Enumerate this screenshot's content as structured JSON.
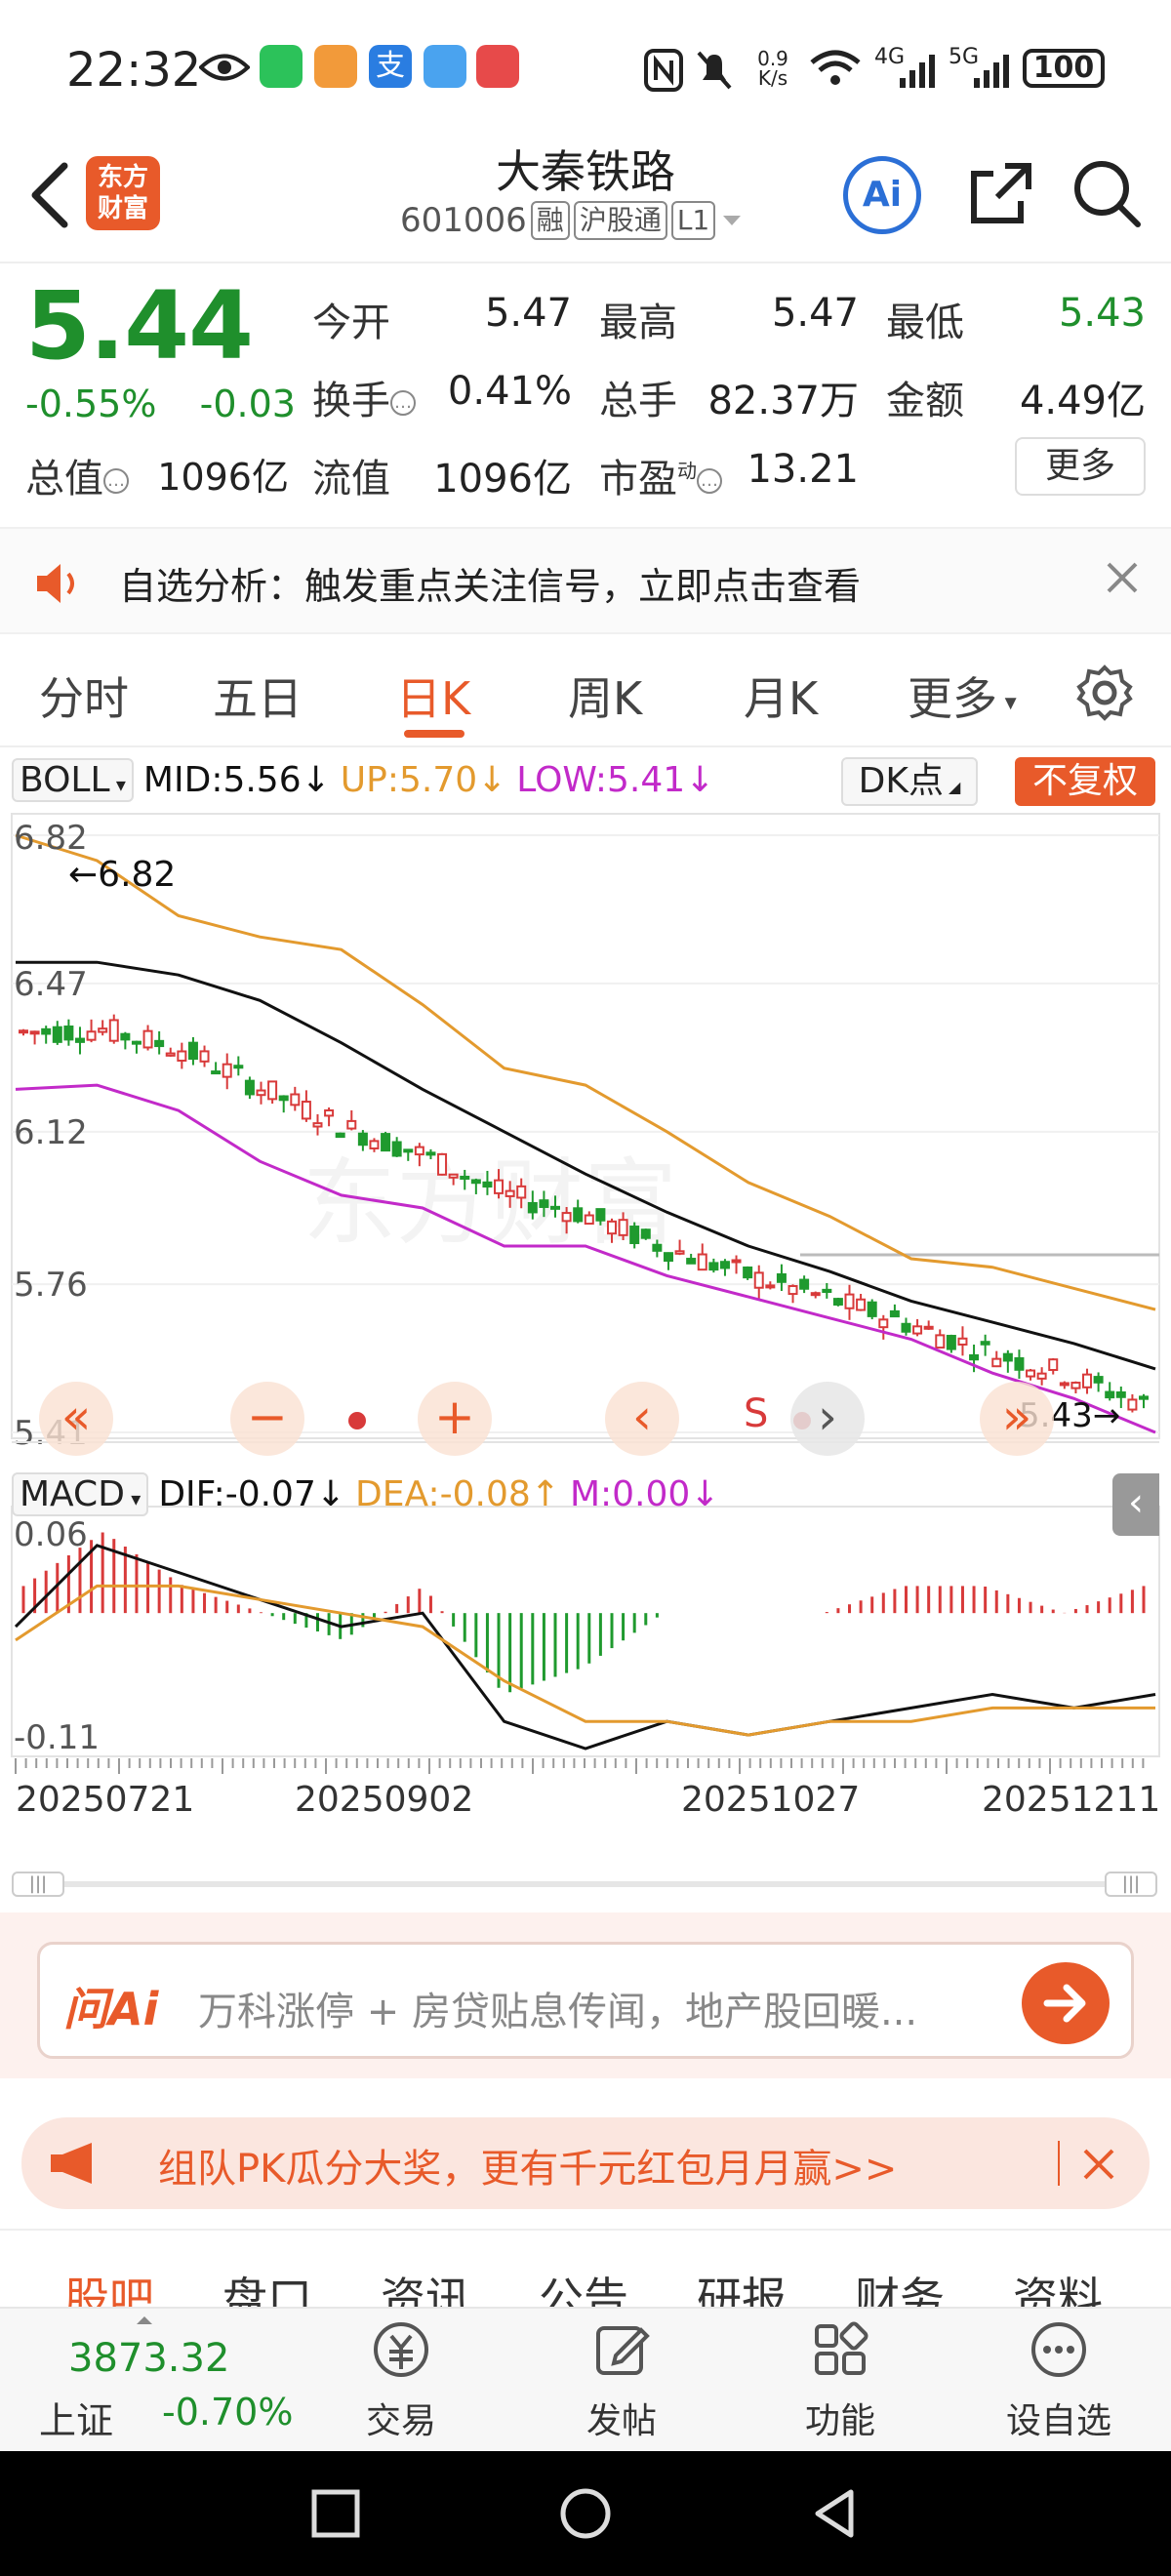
{
  "status_bar": {
    "time": "22:32",
    "net_speed": "0.9 K/s",
    "network": "4G",
    "network2": "5G",
    "battery": "100"
  },
  "header": {
    "brand": "东方财富",
    "stock_name": "大秦铁路",
    "stock_code": "601006",
    "tags": [
      "融",
      "沪股通",
      "L1"
    ],
    "ai_label": "Ai"
  },
  "quote": {
    "price": "5.44",
    "change_pct": "-0.55%",
    "change": "-0.03",
    "open_label": "今开",
    "open": "5.47",
    "high_label": "最高",
    "high": "5.47",
    "low_label": "最低",
    "low": "5.43",
    "turnover_label": "换手",
    "turnover": "0.41%",
    "volume_label": "总手",
    "volume": "82.37万",
    "amount_label": "金额",
    "amount": "4.49亿",
    "mktcap_label": "总值",
    "mktcap": "1096亿",
    "float_label": "流值",
    "float": "1096亿",
    "pe_label": "市盈",
    "pe_sup": "动",
    "pe": "13.21",
    "more_label": "更多"
  },
  "notice": {
    "text": "自选分析：触发重点关注信号，立即点击查看"
  },
  "tabs": [
    "分时",
    "五日",
    "日K",
    "周K",
    "月K",
    "更多"
  ],
  "active_tab": "日K",
  "boll": {
    "name": "BOLL",
    "mid": "MID:5.56",
    "up": "UP:5.70",
    "low": "LOW:5.41",
    "dk_label": "DK点",
    "fq_label": "不复权",
    "max_marker": "←6.82",
    "min_marker": "5.43→",
    "y_ticks": [
      "6.82",
      "6.47",
      "6.12",
      "5.76",
      "5.41"
    ],
    "signal": "S"
  },
  "macd": {
    "name": "MACD",
    "dif": "DIF:-0.07",
    "dea": "DEA:-0.08",
    "m": "M:0.00",
    "y_ticks": [
      "0.06",
      "-0.11"
    ]
  },
  "x_dates": [
    "20250721",
    "20250902",
    "20251027",
    "20251211"
  ],
  "colors": {
    "up": "#d83a3a",
    "down": "#1f9a2e",
    "mid": "#111111",
    "upper": "#e39a2e",
    "lower": "#c22ac9",
    "accent": "#e85a2a"
  },
  "chart_data": [
    {
      "type": "line",
      "title": "BOLL",
      "ylim": [
        5.41,
        6.82
      ],
      "series": [
        {
          "name": "MID",
          "values": [
            6.52,
            6.52,
            6.49,
            6.43,
            6.33,
            6.22,
            6.12,
            6.02,
            5.93,
            5.85,
            5.79,
            5.72,
            5.67,
            5.62,
            5.56
          ]
        },
        {
          "name": "UP",
          "values": [
            6.82,
            6.76,
            6.63,
            6.58,
            6.55,
            6.42,
            6.27,
            6.23,
            6.12,
            6.0,
            5.92,
            5.82,
            5.8,
            5.75,
            5.7
          ]
        },
        {
          "name": "LOW",
          "values": [
            6.22,
            6.23,
            6.17,
            6.05,
            5.97,
            5.94,
            5.85,
            5.85,
            5.78,
            5.73,
            5.68,
            5.63,
            5.55,
            5.49,
            5.41
          ]
        }
      ]
    },
    {
      "type": "line",
      "title": "MACD",
      "ylim": [
        -0.11,
        0.06
      ],
      "series": [
        {
          "name": "DIF",
          "values": [
            -0.02,
            0.04,
            0.02,
            0.0,
            -0.02,
            -0.01,
            -0.09,
            -0.11,
            -0.09,
            -0.1,
            -0.09,
            -0.08,
            -0.07,
            -0.08,
            -0.07
          ]
        },
        {
          "name": "DEA",
          "values": [
            -0.03,
            0.01,
            0.01,
            0.0,
            -0.01,
            -0.02,
            -0.06,
            -0.09,
            -0.09,
            -0.1,
            -0.09,
            -0.09,
            -0.08,
            -0.08,
            -0.08
          ]
        }
      ]
    }
  ],
  "ai_ask": {
    "placeholder": "万科涨停 + 房贷贴息传闻，地产股回暖..."
  },
  "promo": {
    "text": "组队PK瓜分大奖，更有千元红包月月赢>>"
  },
  "sub_tabs": [
    "股吧",
    "盘口",
    "资讯",
    "公告",
    "研报",
    "财务",
    "资料"
  ],
  "bottom": {
    "index_value": "3873.32",
    "index_name": "上证",
    "index_change": "-0.70%",
    "items": [
      "交易",
      "发帖",
      "功能",
      "设自选"
    ]
  }
}
